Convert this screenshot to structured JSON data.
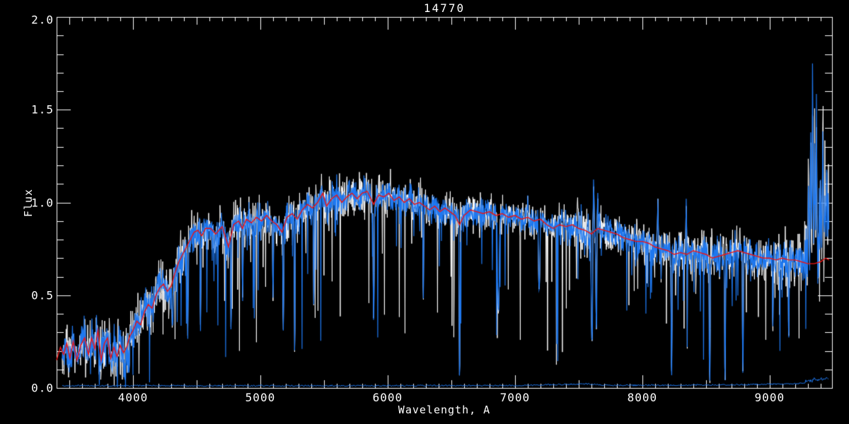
{
  "chart_data": {
    "type": "line",
    "title": "14770",
    "xlabel": "Wavelength, A",
    "ylabel": "Flux",
    "xlim": [
      3400,
      9490
    ],
    "ylim": [
      0.0,
      2.0
    ],
    "grid": false,
    "background_color": "#000000",
    "axis_color": "#ffffff",
    "x_major_ticks": [
      4000,
      5000,
      6000,
      7000,
      8000,
      9000
    ],
    "x_tick_labels": [
      "4000",
      "5000",
      "6000",
      "7000",
      "8000",
      "9000"
    ],
    "x_minor_step": 100,
    "x_medium_step": 500,
    "y_major_ticks": [
      0.0,
      0.5,
      1.0,
      1.5,
      2.0
    ],
    "y_tick_labels": [
      "0.0",
      "0.5",
      "1.0",
      "1.5",
      "2.0"
    ],
    "y_minor_step": 0.1,
    "data_x_range": [
      3444,
      9467
    ],
    "series": [
      {
        "name": "observed-spectrum-noisy",
        "color": "#1e78f0",
        "style": "noisy-line",
        "continuum_ref": "smoothed-spectrum"
      },
      {
        "name": "template-spectrum-white",
        "color": "#ffffff",
        "style": "noisy-line-under",
        "continuum_ref": "smoothed-spectrum"
      },
      {
        "name": "smoothed-spectrum",
        "color": "#ee1414",
        "style": "smooth-line",
        "points": [
          [
            3400,
            0.15
          ],
          [
            3430,
            0.22
          ],
          [
            3455,
            0.18
          ],
          [
            3480,
            0.24
          ],
          [
            3505,
            0.16
          ],
          [
            3530,
            0.25
          ],
          [
            3560,
            0.15
          ],
          [
            3590,
            0.23
          ],
          [
            3620,
            0.27
          ],
          [
            3650,
            0.18
          ],
          [
            3675,
            0.27
          ],
          [
            3700,
            0.21
          ],
          [
            3725,
            0.31
          ],
          [
            3750,
            0.15
          ],
          [
            3775,
            0.24
          ],
          [
            3800,
            0.27
          ],
          [
            3825,
            0.16
          ],
          [
            3850,
            0.22
          ],
          [
            3875,
            0.17
          ],
          [
            3900,
            0.23
          ],
          [
            3925,
            0.19
          ],
          [
            3950,
            0.22
          ],
          [
            3975,
            0.28
          ],
          [
            4000,
            0.31
          ],
          [
            4030,
            0.36
          ],
          [
            4060,
            0.34
          ],
          [
            4090,
            0.41
          ],
          [
            4120,
            0.45
          ],
          [
            4150,
            0.43
          ],
          [
            4180,
            0.5
          ],
          [
            4210,
            0.54
          ],
          [
            4240,
            0.56
          ],
          [
            4270,
            0.52
          ],
          [
            4300,
            0.55
          ],
          [
            4330,
            0.62
          ],
          [
            4360,
            0.68
          ],
          [
            4390,
            0.72
          ],
          [
            4420,
            0.76
          ],
          [
            4450,
            0.8
          ],
          [
            4480,
            0.84
          ],
          [
            4510,
            0.85
          ],
          [
            4540,
            0.82
          ],
          [
            4570,
            0.86
          ],
          [
            4610,
            0.86
          ],
          [
            4650,
            0.83
          ],
          [
            4700,
            0.87
          ],
          [
            4750,
            0.76
          ],
          [
            4790,
            0.88
          ],
          [
            4830,
            0.9
          ],
          [
            4860,
            0.86
          ],
          [
            4890,
            0.91
          ],
          [
            4930,
            0.89
          ],
          [
            4970,
            0.92
          ],
          [
            5010,
            0.9
          ],
          [
            5050,
            0.93
          ],
          [
            5090,
            0.9
          ],
          [
            5130,
            0.88
          ],
          [
            5170,
            0.84
          ],
          [
            5210,
            0.92
          ],
          [
            5250,
            0.94
          ],
          [
            5290,
            0.91
          ],
          [
            5330,
            0.96
          ],
          [
            5370,
            0.99
          ],
          [
            5410,
            0.97
          ],
          [
            5450,
            1.0
          ],
          [
            5490,
            1.05
          ],
          [
            5520,
            0.98
          ],
          [
            5560,
            1.02
          ],
          [
            5600,
            1.04
          ],
          [
            5640,
            1.0
          ],
          [
            5680,
            1.03
          ],
          [
            5720,
            1.05
          ],
          [
            5760,
            1.02
          ],
          [
            5800,
            1.05
          ],
          [
            5840,
            1.06
          ],
          [
            5890,
            0.99
          ],
          [
            5930,
            1.04
          ],
          [
            5970,
            1.03
          ],
          [
            6010,
            1.05
          ],
          [
            6050,
            1.01
          ],
          [
            6090,
            1.03
          ],
          [
            6130,
            1.0
          ],
          [
            6170,
            1.02
          ],
          [
            6210,
            0.99
          ],
          [
            6250,
            1.0
          ],
          [
            6290,
            0.98
          ],
          [
            6330,
            0.96
          ],
          [
            6370,
            0.98
          ],
          [
            6410,
            0.95
          ],
          [
            6450,
            0.97
          ],
          [
            6490,
            0.95
          ],
          [
            6530,
            0.93
          ],
          [
            6565,
            0.88
          ],
          [
            6600,
            0.93
          ],
          [
            6650,
            0.96
          ],
          [
            6700,
            0.95
          ],
          [
            6750,
            0.94
          ],
          [
            6800,
            0.95
          ],
          [
            6850,
            0.93
          ],
          [
            6900,
            0.94
          ],
          [
            6950,
            0.92
          ],
          [
            7000,
            0.93
          ],
          [
            7050,
            0.91
          ],
          [
            7100,
            0.92
          ],
          [
            7150,
            0.9
          ],
          [
            7200,
            0.91
          ],
          [
            7250,
            0.88
          ],
          [
            7300,
            0.86
          ],
          [
            7350,
            0.88
          ],
          [
            7400,
            0.87
          ],
          [
            7450,
            0.88
          ],
          [
            7500,
            0.86
          ],
          [
            7550,
            0.85
          ],
          [
            7600,
            0.83
          ],
          [
            7650,
            0.86
          ],
          [
            7700,
            0.85
          ],
          [
            7750,
            0.84
          ],
          [
            7800,
            0.83
          ],
          [
            7850,
            0.81
          ],
          [
            7900,
            0.8
          ],
          [
            7950,
            0.79
          ],
          [
            8000,
            0.79
          ],
          [
            8050,
            0.78
          ],
          [
            8100,
            0.76
          ],
          [
            8150,
            0.75
          ],
          [
            8200,
            0.74
          ],
          [
            8250,
            0.72
          ],
          [
            8300,
            0.73
          ],
          [
            8350,
            0.72
          ],
          [
            8400,
            0.74
          ],
          [
            8450,
            0.73
          ],
          [
            8500,
            0.72
          ],
          [
            8550,
            0.7
          ],
          [
            8600,
            0.71
          ],
          [
            8650,
            0.72
          ],
          [
            8700,
            0.73
          ],
          [
            8750,
            0.74
          ],
          [
            8800,
            0.73
          ],
          [
            8850,
            0.72
          ],
          [
            8900,
            0.71
          ],
          [
            8950,
            0.7
          ],
          [
            9000,
            0.7
          ],
          [
            9050,
            0.69
          ],
          [
            9100,
            0.7
          ],
          [
            9150,
            0.69
          ],
          [
            9200,
            0.69
          ],
          [
            9250,
            0.68
          ],
          [
            9300,
            0.67
          ],
          [
            9350,
            0.67
          ],
          [
            9400,
            0.68
          ],
          [
            9440,
            0.7
          ],
          [
            9467,
            0.69
          ]
        ]
      },
      {
        "name": "error-spectrum",
        "color": "#1e78f0",
        "style": "noisy-line",
        "points": [
          [
            3444,
            0.012
          ],
          [
            5000,
            0.012
          ],
          [
            7000,
            0.013
          ],
          [
            7580,
            0.022
          ],
          [
            7700,
            0.014
          ],
          [
            8600,
            0.016
          ],
          [
            9200,
            0.022
          ],
          [
            9350,
            0.035
          ],
          [
            9467,
            0.04
          ]
        ]
      }
    ],
    "reconstruction": {
      "noise_envelope": [
        [
          3400,
          0.055
        ],
        [
          3900,
          0.055
        ],
        [
          4100,
          0.05
        ],
        [
          4500,
          0.045
        ],
        [
          5000,
          0.042
        ],
        [
          5500,
          0.045
        ],
        [
          6000,
          0.042
        ],
        [
          6500,
          0.038
        ],
        [
          6900,
          0.035
        ],
        [
          7300,
          0.038
        ],
        [
          7580,
          0.07
        ],
        [
          7670,
          0.04
        ],
        [
          7900,
          0.038
        ],
        [
          8200,
          0.045
        ],
        [
          8600,
          0.05
        ],
        [
          9000,
          0.048
        ],
        [
          9250,
          0.06
        ],
        [
          9320,
          0.12
        ],
        [
          9400,
          0.13
        ],
        [
          9467,
          0.12
        ]
      ],
      "absorption_lines": [
        [
          3735,
          0.05,
          6
        ],
        [
          3835,
          0.08,
          5
        ],
        [
          3935,
          0.04,
          6
        ],
        [
          3970,
          0.07,
          5
        ],
        [
          4310,
          0.3,
          8
        ],
        [
          4430,
          0.25,
          5
        ],
        [
          4530,
          0.3,
          5
        ],
        [
          4770,
          0.3,
          5
        ],
        [
          4861,
          0.45,
          5
        ],
        [
          5100,
          0.45,
          5
        ],
        [
          5180,
          0.3,
          6
        ],
        [
          5270,
          0.15,
          5
        ],
        [
          5420,
          0.42,
          5
        ],
        [
          5890,
          0.34,
          7
        ],
        [
          6280,
          0.45,
          5
        ],
        [
          6565,
          0.02,
          6
        ],
        [
          6870,
          0.4,
          12
        ],
        [
          7190,
          0.5,
          10
        ],
        [
          7605,
          0.22,
          10
        ],
        [
          7640,
          0.3,
          8
        ],
        [
          8230,
          0.05,
          6
        ],
        [
          8350,
          0.0,
          6
        ],
        [
          8530,
          0.0,
          6
        ],
        [
          8650,
          0.0,
          6
        ],
        [
          8790,
          0.05,
          6
        ],
        [
          9025,
          0.3,
          5
        ],
        [
          9150,
          0.25,
          5
        ],
        [
          9370,
          0.2,
          5
        ]
      ],
      "emission_spikes": [
        [
          7100,
          1.05
        ],
        [
          7618,
          1.17
        ],
        [
          7650,
          1.06
        ],
        [
          8122,
          1.06
        ],
        [
          8345,
          1.04
        ],
        [
          9305,
          1.2
        ],
        [
          9322,
          1.45
        ],
        [
          9338,
          1.7
        ],
        [
          9354,
          1.28
        ],
        [
          9368,
          1.52
        ],
        [
          9402,
          1.12
        ],
        [
          9418,
          1.46
        ],
        [
          9434,
          1.08
        ],
        [
          9448,
          1.22
        ],
        [
          9461,
          1.05
        ]
      ],
      "dip_probability_blueward_4800": 0.085,
      "dip_probability_redward_4800": 0.055,
      "white_amp_scale": 1.3,
      "seeds": {
        "white": 1234567,
        "blue": 987651,
        "error": 24680
      }
    }
  }
}
